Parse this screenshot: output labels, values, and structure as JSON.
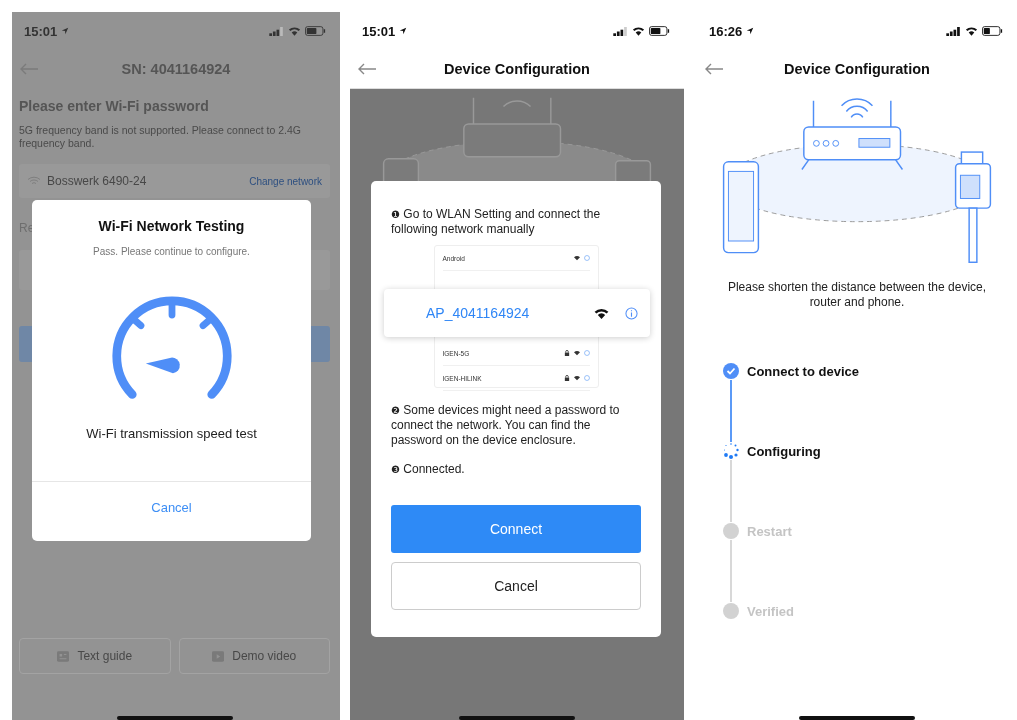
{
  "wifi_test_screen": {
    "status_bar": {
      "time": "15:01"
    },
    "title": "SN: 4041164924",
    "heading": "Please enter Wi-Fi password",
    "note": "5G frequency band is not supported. Please connect to 2.4G frequency band.",
    "network": {
      "name": "Bosswerk 6490-24",
      "action": "Change network"
    },
    "row_label": "Re",
    "footer_buttons": [
      {
        "kind": "guide",
        "label": "Text guide"
      },
      {
        "kind": "video",
        "label": "Demo video"
      }
    ],
    "dialog": {
      "title": "Wi-Fi Network Testing",
      "subtitle": "Pass. Please continue to configure.",
      "caption": "Wi-Fi transmission speed test",
      "cancel": "Cancel"
    }
  },
  "manual_connect_screen": {
    "status_bar": {
      "time": "15:01"
    },
    "title": "Device Configuration",
    "dialog": {
      "steps": [
        {
          "marker": "❶",
          "text": "Go to WLAN Setting and connect the following network manually"
        },
        {
          "marker": "❷",
          "text": "Some devices might need a password to connect the network. You can find the password on the device enclosure."
        },
        {
          "marker": "❸",
          "text": "Connected."
        }
      ],
      "network_list": [
        {
          "name": "Android",
          "locked": false
        },
        {
          "name": "IGEN-5G",
          "locked": true
        },
        {
          "name": "IGEN-HILINK",
          "locked": true
        }
      ],
      "highlighted_network": "AP_4041164924",
      "connect": "Connect",
      "cancel": "Cancel"
    }
  },
  "progress_screen": {
    "status_bar": {
      "time": "16:26"
    },
    "title": "Device Configuration",
    "hint": "Please shorten the distance between the device, router and phone.",
    "steps": [
      {
        "label": "Connect to device",
        "completed": true,
        "current": false
      },
      {
        "label": "Configuring",
        "completed": false,
        "current": true
      },
      {
        "label": "Restart",
        "completed": false,
        "current": false
      },
      {
        "label": "Verified",
        "completed": false,
        "current": false
      }
    ]
  }
}
